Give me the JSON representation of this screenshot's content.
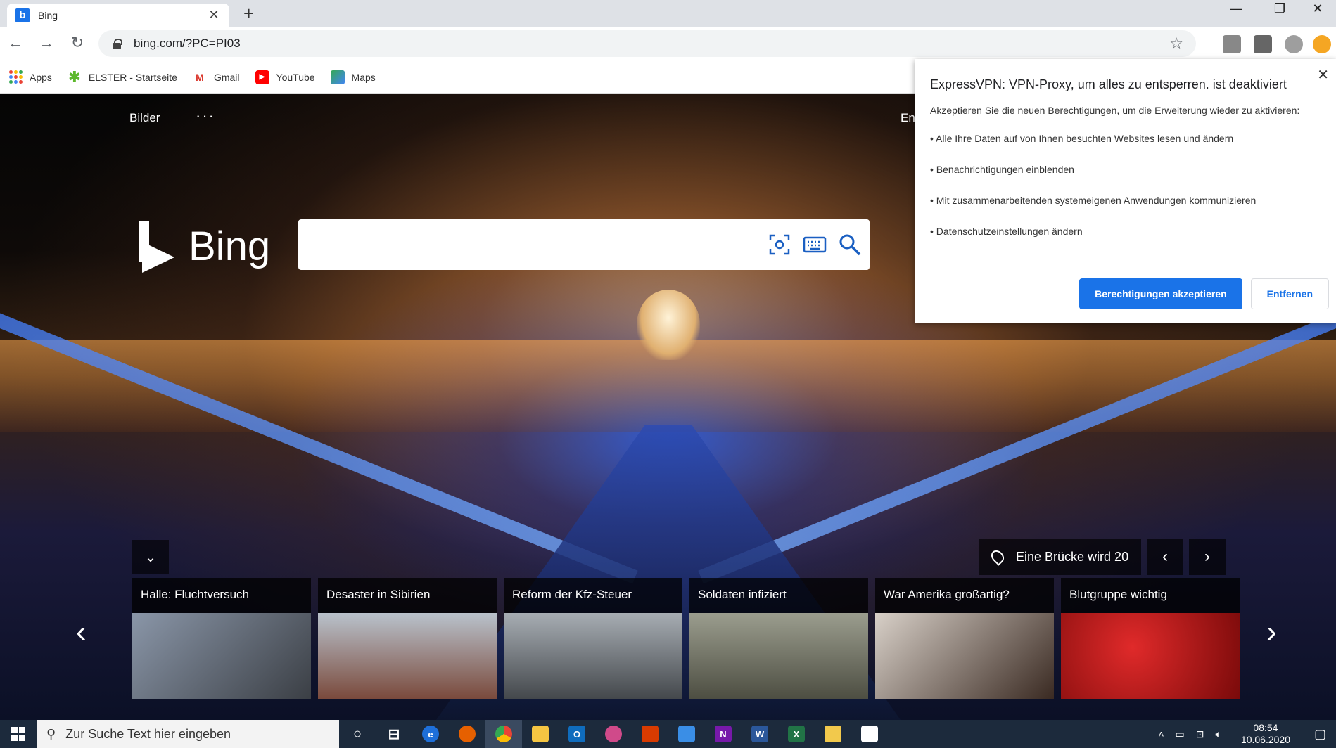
{
  "browser": {
    "tab": {
      "favicon": "b",
      "title": "Bing",
      "close": "✕"
    },
    "new_tab": "+",
    "window_controls": {
      "minimize": "—",
      "restore": "❐",
      "close": "✕"
    },
    "nav": {
      "back": "←",
      "forward": "→",
      "reload": "↻"
    },
    "url": "bing.com/?PC=PI03",
    "star": "☆",
    "bookmarks": [
      {
        "label": "Apps",
        "icon": "apps-grid-icon"
      },
      {
        "label": "ELSTER - Startseite",
        "icon": "elster-star-icon"
      },
      {
        "label": "Gmail",
        "icon": "gmail-icon"
      },
      {
        "label": "YouTube",
        "icon": "youtube-icon"
      },
      {
        "label": "Maps",
        "icon": "maps-icon"
      }
    ]
  },
  "bing": {
    "link_images": "Bilder",
    "more": "···",
    "partial_link": "En",
    "logo_text": "Bing",
    "search_placeholder": "",
    "collapse": "⌄",
    "location_text": "Eine Brücke wird 20",
    "prev": "‹",
    "next": "›",
    "news": [
      {
        "title": "Halle: Fluchtversuch",
        "colors": [
          "#8a96a8",
          "#3b3f45"
        ]
      },
      {
        "title": "Desaster in Sibirien",
        "colors": [
          "#b9c2cc",
          "#7a4a3c"
        ]
      },
      {
        "title": "Reform der Kfz-Steuer",
        "colors": [
          "#a7adb3",
          "#44484c"
        ]
      },
      {
        "title": "Soldaten infiziert",
        "colors": [
          "#9b9d8e",
          "#4d4e42"
        ]
      },
      {
        "title": "War Amerika großartig?",
        "colors": [
          "#d8d0c8",
          "#3a2a22"
        ]
      },
      {
        "title": "Blutgruppe wichtig",
        "colors": [
          "#e02a2a",
          "#7a0a0a"
        ]
      }
    ]
  },
  "popup": {
    "close": "✕",
    "title": "ExpressVPN: VPN-Proxy, um alles zu entsperren. ist deaktiviert",
    "subtitle": "Akzeptieren Sie die neuen Berechtigungen, um die Erweiterung wieder zu aktivieren:",
    "items": [
      "• Alle Ihre Daten auf von Ihnen besuchten Websites lesen und ändern",
      "• Benachrichtigungen einblenden",
      "• Mit zusammenarbeitenden systemeigenen Anwendungen kommunizieren",
      "• Datenschutzeinstellungen ändern"
    ],
    "accept": "Berechtigungen akzeptieren",
    "remove": "Entfernen"
  },
  "taskbar": {
    "search_placeholder": "Zur Suche Text hier eingeben",
    "apps": [
      {
        "name": "cortana",
        "label": "○",
        "color": "transparent"
      },
      {
        "name": "task-view",
        "label": "⊟",
        "color": "transparent"
      },
      {
        "name": "edge",
        "label": "e",
        "color": "#1e6fd9"
      },
      {
        "name": "firefox",
        "label": "",
        "color": "#e66000"
      },
      {
        "name": "chrome",
        "label": "",
        "color": "#34a853"
      },
      {
        "name": "explorer",
        "label": "",
        "color": "#f4c542"
      },
      {
        "name": "outlook",
        "label": "O",
        "color": "#0f6cbd"
      },
      {
        "name": "paint",
        "label": "",
        "color": "#d04a8a"
      },
      {
        "name": "office",
        "label": "",
        "color": "#d83b01"
      },
      {
        "name": "photos",
        "label": "",
        "color": "#3a8ee6"
      },
      {
        "name": "onenote",
        "label": "N",
        "color": "#7719aa"
      },
      {
        "name": "word",
        "label": "W",
        "color": "#2b579a"
      },
      {
        "name": "excel",
        "label": "X",
        "color": "#217346"
      },
      {
        "name": "files",
        "label": "",
        "color": "#f2c94c"
      },
      {
        "name": "store",
        "label": "",
        "color": "#ffffff"
      }
    ],
    "time": "08:54",
    "date": "10.06.2020"
  }
}
